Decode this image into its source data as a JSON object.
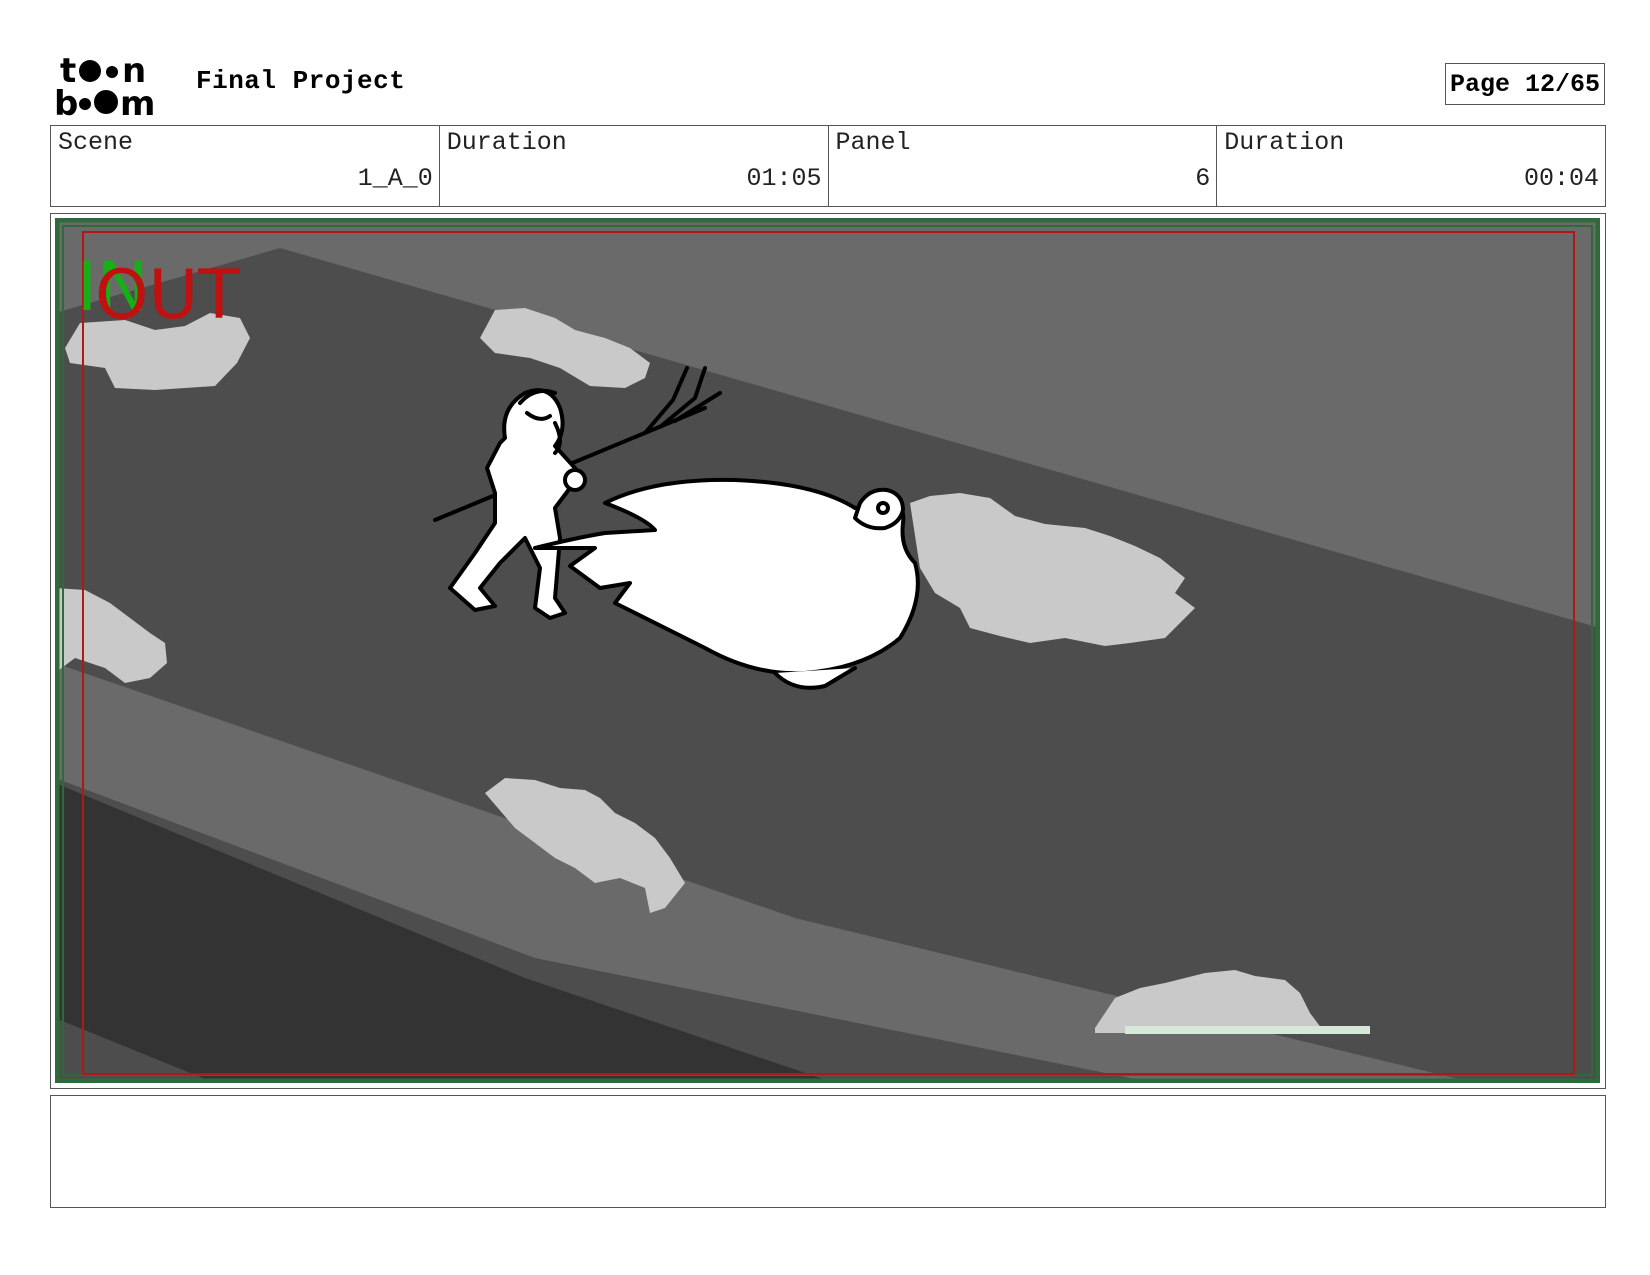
{
  "header": {
    "logo_alt": "toon boom",
    "project_title": "Final Project",
    "page_label": "Page 12/65"
  },
  "info": [
    {
      "label": "Scene",
      "value": "1_A_0"
    },
    {
      "label": "Duration",
      "value": "01:05"
    },
    {
      "label": "Panel",
      "value": "6"
    },
    {
      "label": "Duration",
      "value": "00:04"
    }
  ],
  "panel": {
    "in_marker": "IN",
    "out_marker": "OUT",
    "colors": {
      "in_marker": "#16b016",
      "out_marker": "#c01010",
      "frame_green": "#2f6b3a",
      "frame_red": "#b01818",
      "sky_light": "#6a6a6a",
      "sky_mid": "#4d4d4d",
      "sky_dark": "#333333",
      "cloud": "#c9c9c9"
    }
  },
  "notes": {
    "text": ""
  }
}
